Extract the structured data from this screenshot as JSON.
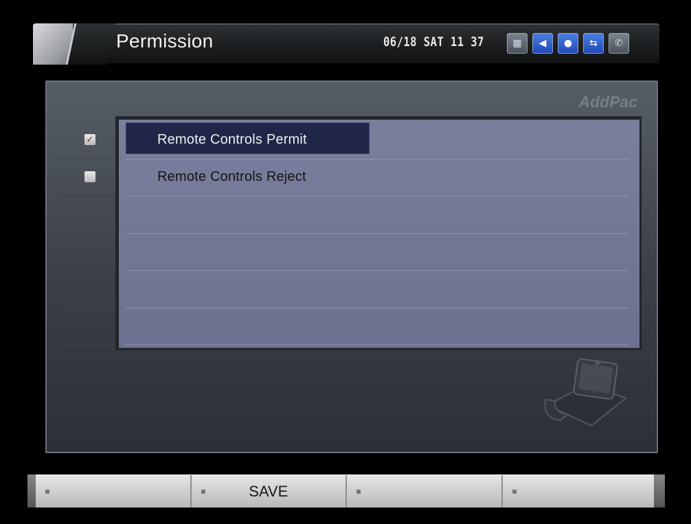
{
  "header": {
    "title": "Permission",
    "clock": "06/18 SAT 11 37",
    "status_icons": [
      {
        "name": "keypad-icon",
        "style": "grey",
        "glyph": "▦"
      },
      {
        "name": "speaker-icon",
        "style": "blue",
        "glyph": "◀"
      },
      {
        "name": "user-icon",
        "style": "blue",
        "glyph": "●"
      },
      {
        "name": "network-icon",
        "style": "blue",
        "glyph": "⇆"
      },
      {
        "name": "phone-icon",
        "style": "grey",
        "glyph": "✆"
      }
    ]
  },
  "brand": "AddPac",
  "options": [
    {
      "label": "Remote Controls Permit",
      "checked": true,
      "selected": true
    },
    {
      "label": "Remote Controls Reject",
      "checked": false,
      "selected": false
    }
  ],
  "empty_rows": 4,
  "footer": {
    "keys": [
      {
        "label": ""
      },
      {
        "label": "SAVE"
      },
      {
        "label": ""
      },
      {
        "label": ""
      }
    ]
  },
  "colors": {
    "list_background": "#757a97",
    "selected_row": "#202648",
    "panel": "#474c55",
    "status_blue": "#2f5fcc"
  }
}
